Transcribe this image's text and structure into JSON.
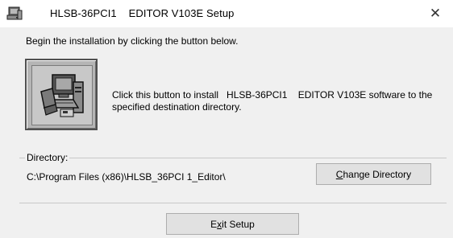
{
  "window": {
    "title": "HLSB-36PCI1    EDITOR V103E Setup",
    "close_glyph": "✕",
    "icon": "setup-computer-icon"
  },
  "intro": {
    "text": "Begin the installation by clicking the button below."
  },
  "install": {
    "icon": "install-computer-icon",
    "description_line1": "Click this button to install   HLSB-36PCI1    EDITOR V103E software to the",
    "description_line2": "specified destination directory."
  },
  "directory": {
    "legend": "Directory:",
    "path": "C:\\Program Files (x86)\\HLSB_36PCI 1_Editor\\",
    "change_button_mnemonic": "C",
    "change_button_rest": "hange Directory"
  },
  "footer": {
    "exit_button_pre": "E",
    "exit_button_mnemonic": "x",
    "exit_button_rest": "it Setup"
  }
}
